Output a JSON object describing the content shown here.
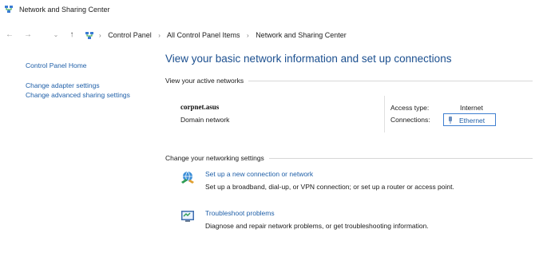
{
  "window": {
    "title": "Network and Sharing Center"
  },
  "navigation": {
    "back_glyph": "←",
    "forward_glyph": "→",
    "recent_glyph": "⌄",
    "up_glyph": "↑",
    "breadcrumbs": [
      "Control Panel",
      "All Control Panel Items",
      "Network and Sharing Center"
    ],
    "separator": "›"
  },
  "sidebar": {
    "home": "Control Panel Home",
    "links": [
      "Change adapter settings",
      "Change advanced sharing settings"
    ]
  },
  "main": {
    "title": "View your basic network information and set up connections",
    "active_networks_header": "View your active networks",
    "network": {
      "name": "corpnet.asus",
      "category": "Domain network",
      "access_type_label": "Access type:",
      "access_type_value": "Internet",
      "connections_label": "Connections:",
      "connection_name": "Ethernet"
    },
    "change_settings_header": "Change your networking settings",
    "tasks": [
      {
        "icon": "network-setup-icon",
        "link": "Set up a new connection or network",
        "description": "Set up a broadband, dial-up, or VPN connection; or set up a router or access point."
      },
      {
        "icon": "troubleshoot-icon",
        "link": "Troubleshoot problems",
        "description": "Diagnose and repair network problems, or get troubleshooting information."
      }
    ]
  },
  "colors": {
    "link": "#1f5fa8",
    "title": "#1b4f8f",
    "focus_border": "#3f7fd0"
  }
}
